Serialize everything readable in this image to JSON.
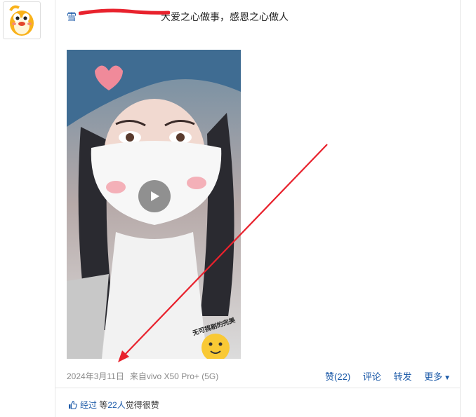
{
  "post": {
    "author_visible": "雪",
    "text": "大爱之心做事，感恩之心做人"
  },
  "media": {
    "type": "video",
    "sticker_text": "无可挑剔的完美"
  },
  "meta": {
    "date": "2024年3月11日",
    "source": "来自vivo X50 Pro+ (5G)"
  },
  "actions": {
    "like": "赞(22)",
    "comment": "评论",
    "forward": "转发",
    "more": "更多"
  },
  "likes": {
    "name": "经过",
    "count_text": "22人",
    "prefix": "等",
    "suffix": "觉得很赞"
  },
  "colors": {
    "link": "#1c5aa8",
    "meta": "#8a8a8a",
    "annotation": "#e8222d"
  },
  "icons": [
    "qq-penguin-avatar-icon",
    "play-icon",
    "caret-down-icon",
    "thumbs-up-icon",
    "annotation-arrow"
  ]
}
